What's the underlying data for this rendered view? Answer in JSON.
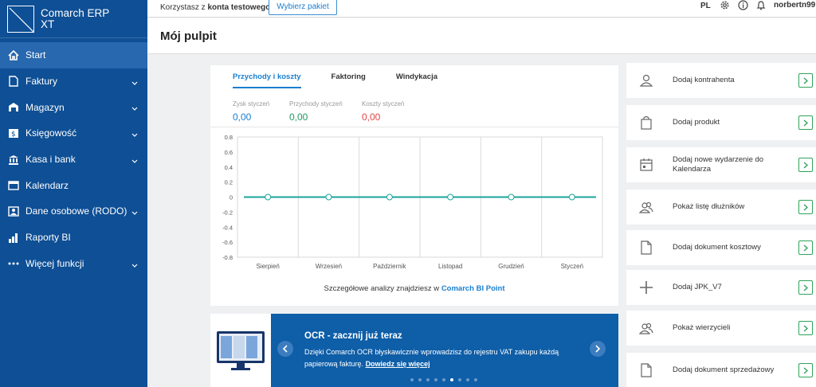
{
  "app": {
    "name_line1": "Comarch ERP",
    "name_line2": "XT"
  },
  "sidebar": {
    "items": [
      {
        "label": "Start"
      },
      {
        "label": "Faktury"
      },
      {
        "label": "Magazyn"
      },
      {
        "label": "Księgowość"
      },
      {
        "label": "Kasa i bank"
      },
      {
        "label": "Kalendarz"
      },
      {
        "label": "Dane osobowe (RODO)"
      },
      {
        "label": "Raporty BI"
      },
      {
        "label": "Więcej funkcji"
      }
    ]
  },
  "topbar": {
    "prefix": "Korzystasz z",
    "account": "konta testowego",
    "package_button": "Wybierz pakiet",
    "lang": "PL",
    "user": "norbertn99"
  },
  "page": {
    "title": "Mój pulpit"
  },
  "tabs": [
    {
      "label": "Przychody i koszty"
    },
    {
      "label": "Faktoring"
    },
    {
      "label": "Windykacja"
    }
  ],
  "stats": [
    {
      "label": "Zysk styczeń",
      "value": "0,00"
    },
    {
      "label": "Przychody styczeń",
      "value": "0,00"
    },
    {
      "label": "Koszty styczeń",
      "value": "0,00"
    }
  ],
  "chart_data": {
    "type": "line",
    "categories": [
      "Sierpień",
      "Wrzesień",
      "Październik",
      "Listopad",
      "Grudzień",
      "Styczeń"
    ],
    "series": [
      {
        "values": [
          0,
          0,
          0,
          0,
          0,
          0
        ]
      }
    ],
    "yticks": [
      "0.8",
      "0.6",
      "0.4",
      "0.2",
      "0",
      "-0.2",
      "-0.4",
      "-0.6",
      "-0.8"
    ],
    "ylim": [
      -0.8,
      0.8
    ],
    "grid": true,
    "colors": {
      "line": "#1aa59a",
      "marker": "#1aa59a"
    }
  },
  "analytics": {
    "text": "Szczegółowe analizy znajdziesz w",
    "link": "Comarch BI Point"
  },
  "ocr": {
    "title": "OCR - zacznij już teraz",
    "text": "Dzięki Comarch OCR błyskawicznie wprowadzisz do rejestru VAT zakupu każdą papierową fakturę.",
    "link": "Dowiedz się więcej"
  },
  "actions": [
    {
      "label": "Dodaj kontrahenta",
      "icon": "person-icon"
    },
    {
      "label": "Dodaj produkt",
      "icon": "bag-icon"
    },
    {
      "label": "Dodaj nowe wydarzenie do Kalendarza",
      "icon": "calendar-icon"
    },
    {
      "label": "Pokaż listę dłużników",
      "icon": "people-icon"
    },
    {
      "label": "Dodaj dokument kosztowy",
      "icon": "document-icon"
    },
    {
      "label": "Dodaj JPK_V7",
      "icon": "plus-icon"
    },
    {
      "label": "Pokaż wierzycieli",
      "icon": "people-icon"
    },
    {
      "label": "Dodaj dokument sprzedażowy",
      "icon": "document-icon"
    }
  ]
}
